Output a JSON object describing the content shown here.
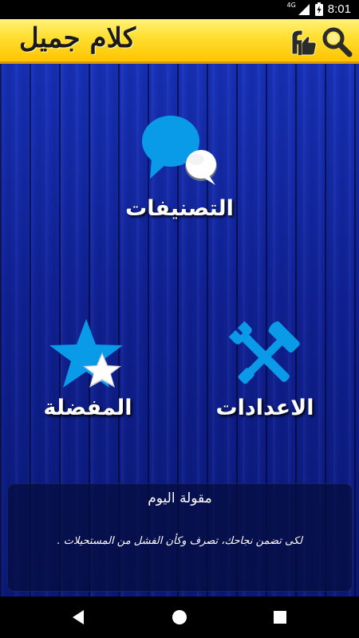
{
  "status_bar": {
    "time": "8:01",
    "network": "4G"
  },
  "app_bar": {
    "title": "كلام جميل",
    "icons": [
      "facebook-like-icon",
      "search-icon"
    ]
  },
  "menu": {
    "categories": {
      "label": "التصنيفات",
      "icon": "chat-bubbles-icon"
    },
    "settings": {
      "label": "الاعدادات",
      "icon": "tools-icon"
    },
    "favorites": {
      "label": "المفضلة",
      "icon": "star-icon"
    }
  },
  "quote_of_day": {
    "title": "مقولة اليوم",
    "text": "لكى تضمن نجاحك، تصرف وكأن الفشل من المستحيلات ."
  },
  "colors": {
    "app_bar": "#ffd21f",
    "background": "#0f2296",
    "accent": "#0a9be8"
  },
  "nav_bar": {
    "buttons": [
      "back-icon",
      "home-icon",
      "recents-icon"
    ]
  }
}
